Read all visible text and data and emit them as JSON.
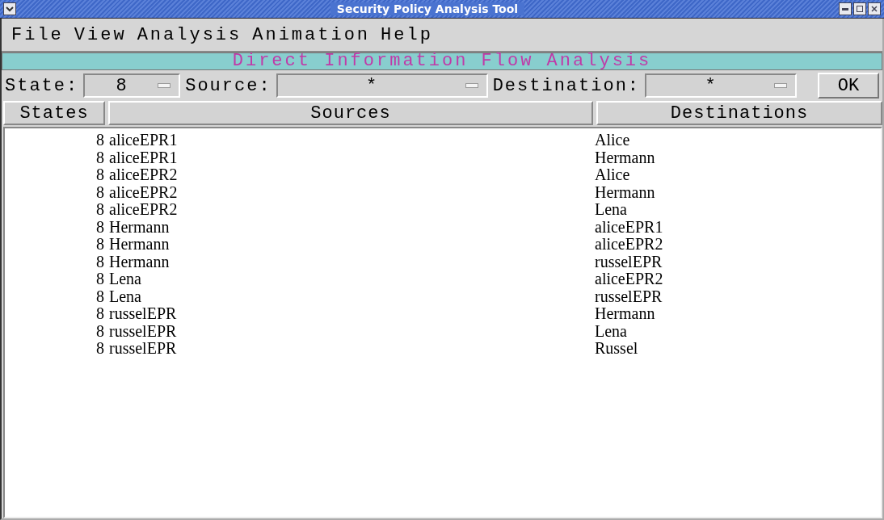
{
  "window": {
    "title": "Security Policy Analysis Tool"
  },
  "menu": [
    "File",
    "View",
    "Analysis",
    "Animation",
    "Help"
  ],
  "banner": "Direct Information Flow Analysis",
  "filters": [
    {
      "label": "State:",
      "value": "8"
    },
    {
      "label": "Source:",
      "value": "*"
    },
    {
      "label": "Destination:",
      "value": "*"
    }
  ],
  "ok_button": "OK",
  "table": {
    "columns": [
      "States",
      "Sources",
      "Destinations"
    ],
    "rows": [
      [
        "8",
        "aliceEPR1",
        "Alice"
      ],
      [
        "8",
        "aliceEPR1",
        "Hermann"
      ],
      [
        "8",
        "aliceEPR2",
        "Alice"
      ],
      [
        "8",
        "aliceEPR2",
        "Hermann"
      ],
      [
        "8",
        "aliceEPR2",
        "Lena"
      ],
      [
        "8",
        "Hermann",
        "aliceEPR1"
      ],
      [
        "8",
        "Hermann",
        "aliceEPR2"
      ],
      [
        "8",
        "Hermann",
        "russelEPR"
      ],
      [
        "8",
        "Lena",
        "aliceEPR2"
      ],
      [
        "8",
        "Lena",
        "russelEPR"
      ],
      [
        "8",
        "russelEPR",
        "Hermann"
      ],
      [
        "8",
        "russelEPR",
        "Lena"
      ],
      [
        "8",
        "russelEPR",
        "Russel"
      ]
    ]
  }
}
